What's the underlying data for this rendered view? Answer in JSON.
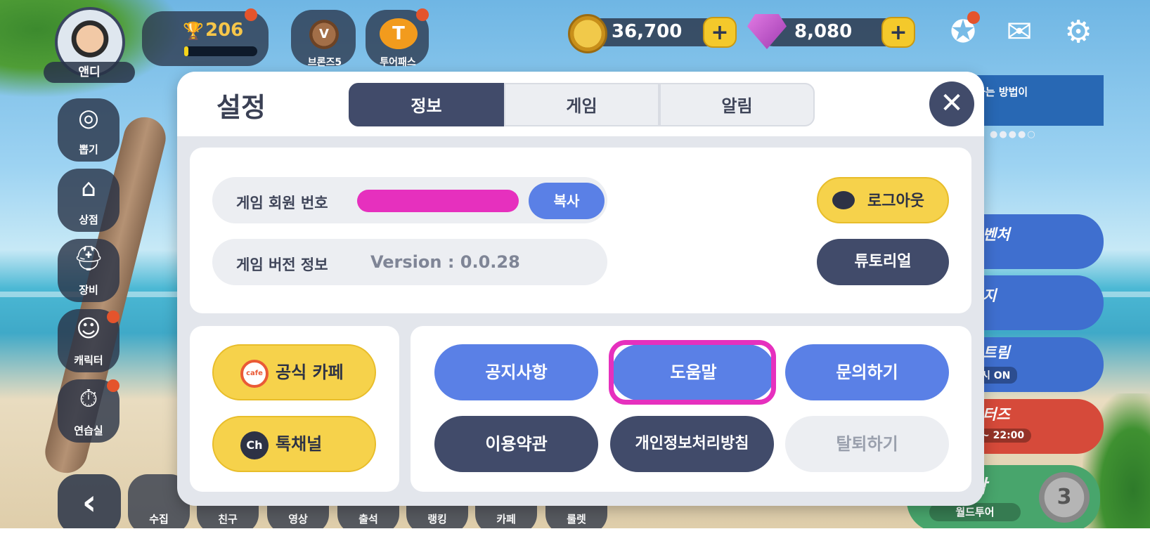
{
  "hud": {
    "player_name": "앤디",
    "trophy_count": "206",
    "trophy_progress": 0.04,
    "rank_label": "브론즈5",
    "rank_medal_letter": "V",
    "tourpass_label": "투어패스",
    "tourpass_letter": "T",
    "coins": "36,700",
    "gems": "8,080",
    "coin_plus": "+",
    "gem_plus": "+"
  },
  "side_menu": [
    {
      "label": "뽑기",
      "icon": "target-icon"
    },
    {
      "label": "상점",
      "icon": "shop-icon"
    },
    {
      "label": "장비",
      "icon": "gear-equipment-icon"
    },
    {
      "label": "캐릭터",
      "icon": "character-icon"
    },
    {
      "label": "연습실",
      "icon": "practice-icon"
    }
  ],
  "bottom_bar": [
    {
      "label": "수집"
    },
    {
      "label": "친구"
    },
    {
      "label": "영상"
    },
    {
      "label": "출석"
    },
    {
      "label": "랭킹"
    },
    {
      "label": "카페"
    },
    {
      "label": "룰렛"
    }
  ],
  "right_panel": {
    "banner_text": "하는 방법이",
    "event_1": "벤처",
    "event_2": "지",
    "event_3": "트림",
    "event_3_sub": "시 ON",
    "event_4": "터즈",
    "event_4_sub": "~ 22:00",
    "start_title": "작",
    "start_sub": "월드투어",
    "start_badge": "3"
  },
  "modal": {
    "title": "설정",
    "tabs": [
      "정보",
      "게임",
      "알림"
    ],
    "active_tab": 0,
    "close_symbol": "✕",
    "member_label": "게임 회원 번호",
    "copy_label": "복사",
    "version_label": "게임 버전 정보",
    "version_value": "Version : 0.0.28",
    "logout_label": "로그아웃",
    "tutorial_label": "튜토리얼",
    "cafe_label": "공식 카페",
    "cafe_icon_text": "cafe",
    "channel_label": "톡채널",
    "channel_icon_text": "Ch",
    "buttons": {
      "notice": "공지사항",
      "help": "도움말",
      "inquiry": "문의하기",
      "terms": "이용약관",
      "privacy": "개인정보처리방침",
      "withdraw": "탈퇴하기"
    }
  },
  "colors": {
    "accent_blue": "#5a80e6",
    "dark_navy": "#414b6a",
    "yellow": "#f6d24b",
    "highlight_magenta": "#e630be"
  }
}
